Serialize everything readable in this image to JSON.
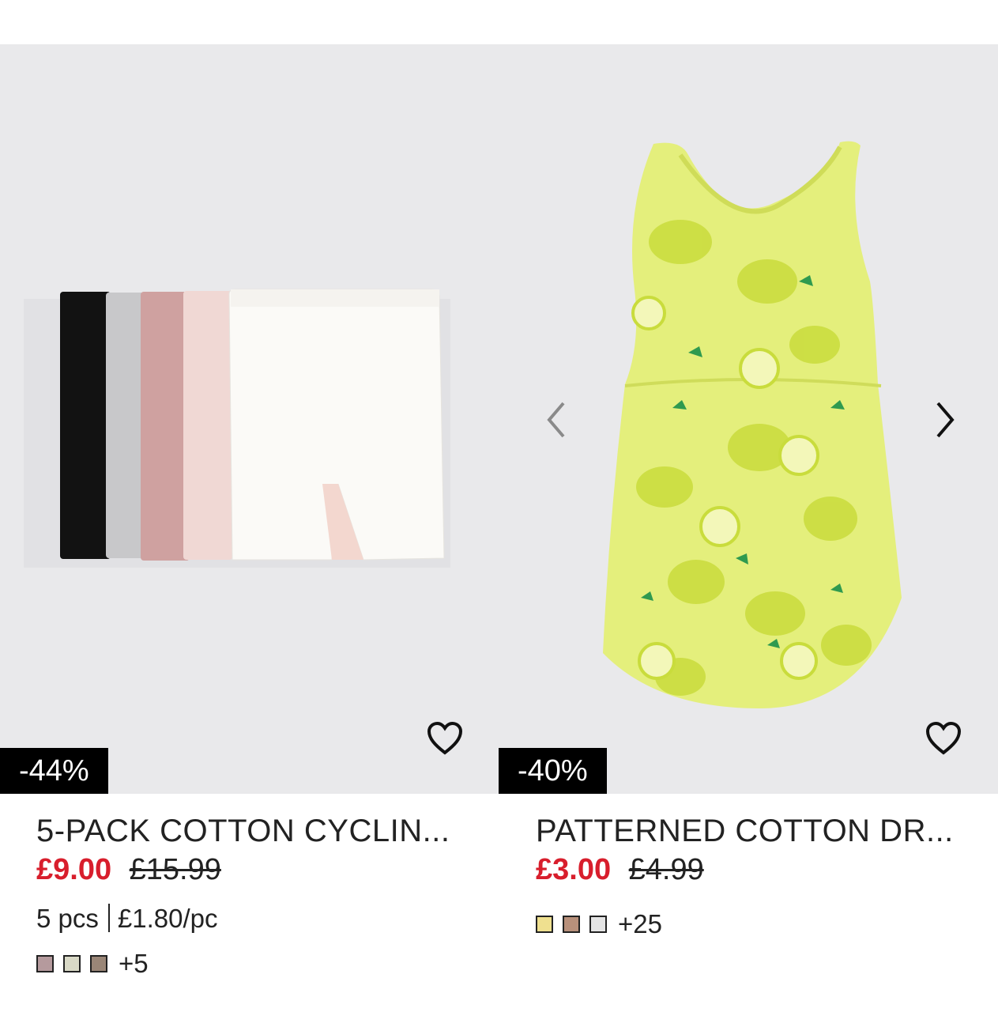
{
  "products": [
    {
      "discount_badge": "-44%",
      "title": "5-PACK COTTON CYCLIN...",
      "price_now": "£9.00",
      "price_old": "£15.99",
      "pack_size": "5 pcs",
      "unit_price": "£1.80/pc",
      "swatch_colors": [
        "#b59a9d",
        "#d9d9c6",
        "#9a8677"
      ],
      "more_colors": "+5"
    },
    {
      "discount_badge": "-40%",
      "title": "PATTERNED COTTON DR...",
      "price_now": "£3.00",
      "price_old": "£4.99",
      "swatch_colors": [
        "#efe08f",
        "#b8907b",
        "#e4e4e4"
      ],
      "more_colors": "+25"
    }
  ],
  "icons": {
    "favorite": "heart-outline-icon",
    "prev": "chevron-left-icon",
    "next": "chevron-right-icon"
  },
  "colors": {
    "sale_red": "#d81e2c",
    "image_background": "#e9e9eb",
    "badge_background": "#000000"
  }
}
